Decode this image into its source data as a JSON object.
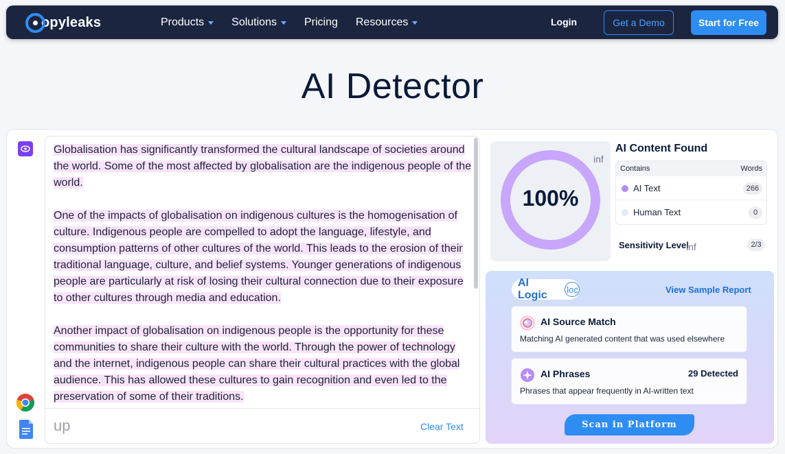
{
  "nav": {
    "logo_text": "opyleaks",
    "menu": [
      {
        "label": "Products",
        "dropdown": true
      },
      {
        "label": "Solutions",
        "dropdown": true
      },
      {
        "label": "Pricing",
        "dropdown": false
      },
      {
        "label": "Resources",
        "dropdown": true
      }
    ],
    "login": "Login",
    "demo": "Get a Demo",
    "start": "Start for Free"
  },
  "page_title": "AI Detector",
  "editor": {
    "paragraphs": [
      "Globalisation has significantly transformed the cultural landscape of societies around the world. Some of the most affected by globalisation are the indigenous people of the world.",
      "One of the impacts of globalisation on indigenous cultures is the homogenisation of culture. Indigenous people are compelled to adopt the language, lifestyle, and consumption patterns of other cultures of the world. This leads to the erosion of their traditional language, culture, and belief systems. Younger generations of indigenous people are particularly at risk of losing their cultural connection due to their exposure to other cultures through media and education.",
      "Another impact of globalisation on indigenous people is the opportunity for these communities to share their culture with the world. Through the power of technology and the internet, indigenous people can share their cultural practices with the global audience. This has allowed these cultures to gain recognition and even led to the preservation of some of their traditions."
    ],
    "upload_hint": "up",
    "clear": "Clear Text"
  },
  "result": {
    "percent": "100%",
    "percent_value": 100,
    "gauge_info": "inf",
    "title": "AI Content Found",
    "table_head": {
      "contains": "Contains",
      "words": "Words"
    },
    "rows": [
      {
        "label": "AI Text",
        "count": "266",
        "color": "#b38cf3"
      },
      {
        "label": "Human Text",
        "count": "0",
        "color": "#e3ebf7"
      }
    ],
    "sensitivity_label": "Sensitivity Level",
    "sensitivity_info": "inf",
    "sensitivity_value": "2/3"
  },
  "logic": {
    "pill_label": "AI Logic",
    "pill_icon": "loc",
    "view_sample": "View Sample Report",
    "features": [
      {
        "title": "AI Source Match",
        "extra": "",
        "desc": "Matching AI generated content that was used elsewhere",
        "icon": "source-match-icon"
      },
      {
        "title": "AI Phrases",
        "extra": "29 Detected",
        "desc": "Phrases that appear frequently in AI-written text",
        "icon": "sparkle-icon"
      }
    ],
    "scan": "Scan in Platform"
  },
  "colors": {
    "nav_bg": "#1b2540",
    "accent": "#2e8df2",
    "highlight": "#f9e3fb",
    "gauge": "#c7a6fb"
  }
}
